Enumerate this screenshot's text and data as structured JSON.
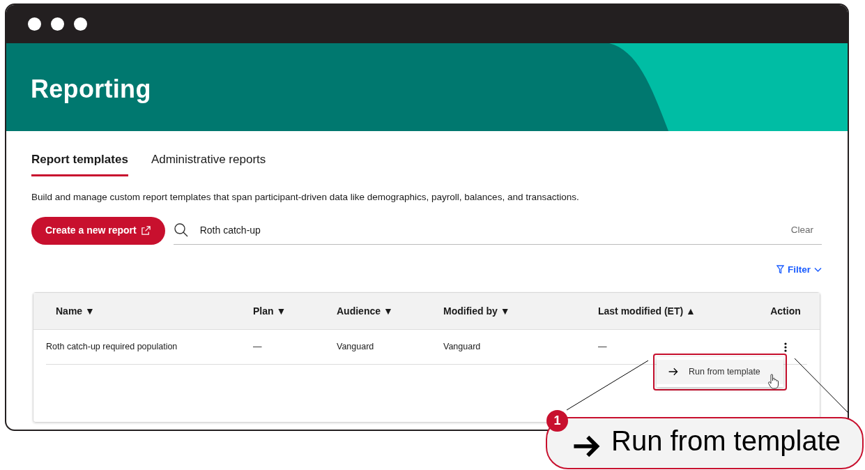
{
  "header": {
    "title": "Reporting"
  },
  "tabs": [
    {
      "label": "Report templates",
      "selected": true
    },
    {
      "label": "Administrative reports",
      "selected": false
    }
  ],
  "description": "Build and manage custom report templates that span participant-driven data like demographics, payroll, balances, and transactions.",
  "create_button": {
    "label": "Create a new report"
  },
  "search": {
    "value": "Roth catch-up",
    "clear": "Clear"
  },
  "filter": {
    "label": "Filter"
  },
  "table": {
    "columns": [
      {
        "label": "Name",
        "sort": "▼"
      },
      {
        "label": "Plan",
        "sort": "▼"
      },
      {
        "label": "Audience",
        "sort": "▼"
      },
      {
        "label": "Modified by",
        "sort": "▼"
      },
      {
        "label": "Last modified (ET)",
        "sort": "▲"
      },
      {
        "label": "Action"
      }
    ],
    "rows": [
      {
        "cells": [
          "Roth catch-up required population",
          "—",
          "Vanguard",
          "Vanguard",
          "—"
        ]
      }
    ]
  },
  "row_menu": {
    "items": [
      {
        "label": "Run from template",
        "highlighted": true
      }
    ]
  },
  "callout": {
    "number": "1",
    "label": "Run from template"
  }
}
